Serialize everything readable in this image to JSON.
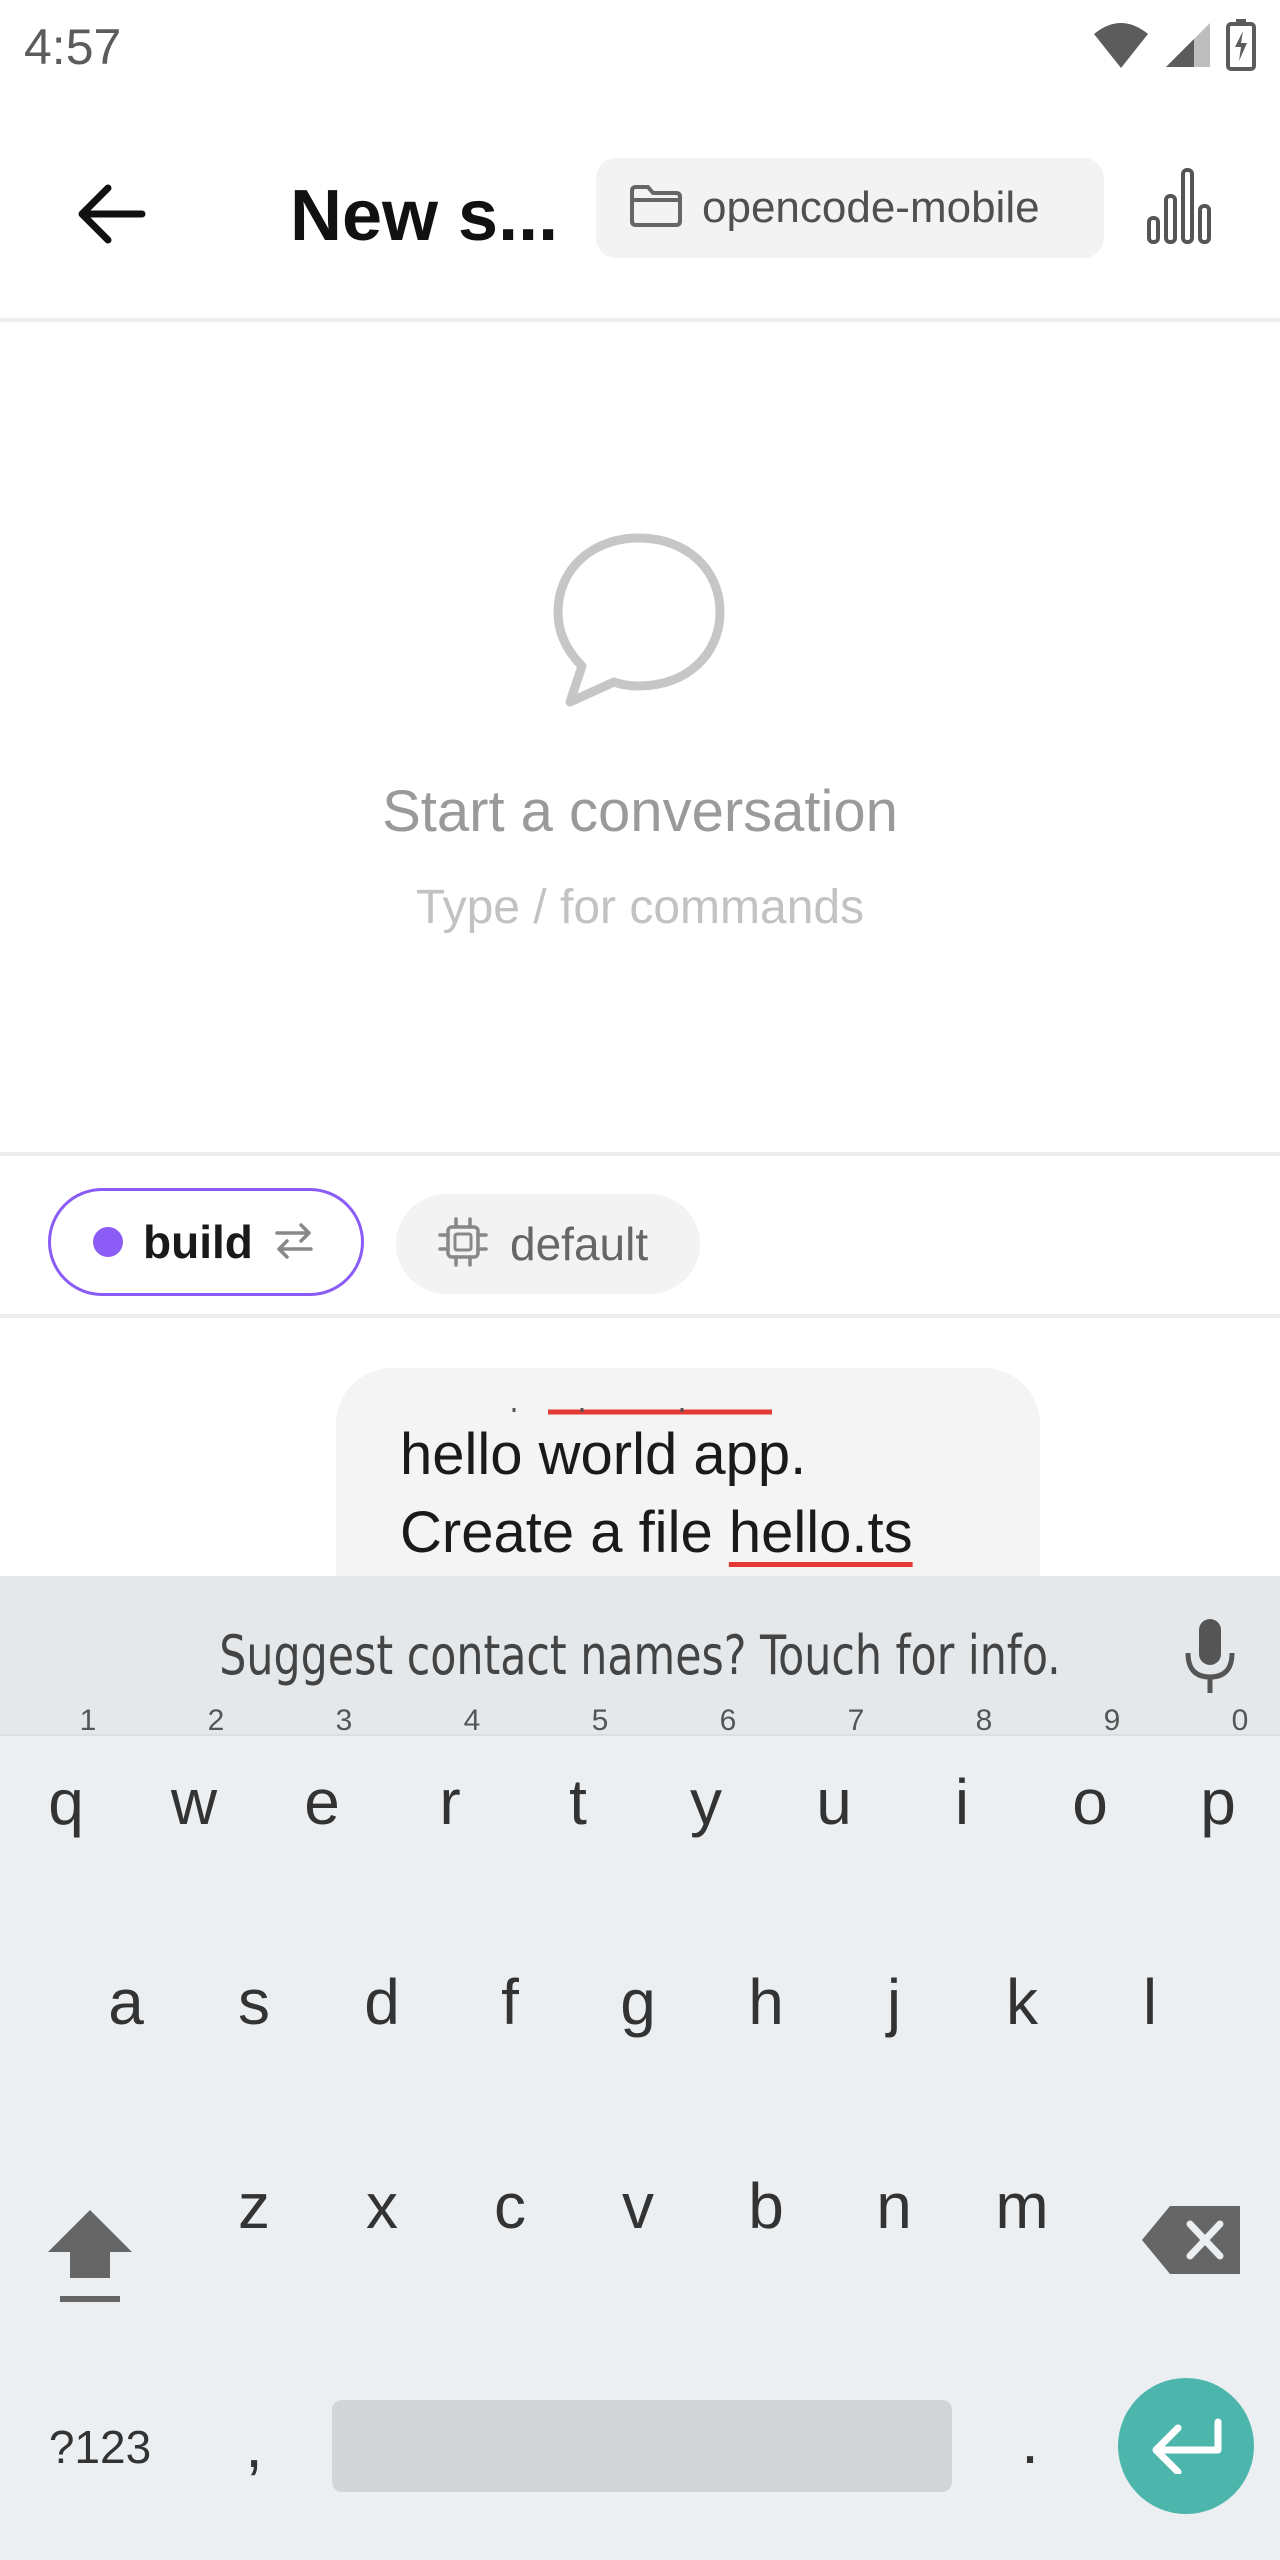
{
  "status_bar": {
    "time": "4:57"
  },
  "header": {
    "title": "New s...",
    "project": "opencode-mobile"
  },
  "empty_state": {
    "title": "Start a conversation",
    "subtitle": "Type / for commands"
  },
  "chips": {
    "agent": "build",
    "model": "default"
  },
  "message": {
    "line1": "hello world app.",
    "line2_prefix": "Create a file ",
    "line2_file": "hello.ts"
  },
  "keyboard": {
    "suggestion": "Suggest contact names? Touch for info.",
    "row1": [
      "q",
      "w",
      "e",
      "r",
      "t",
      "y",
      "u",
      "i",
      "o",
      "p"
    ],
    "row1_hints": [
      "1",
      "2",
      "3",
      "4",
      "5",
      "6",
      "7",
      "8",
      "9",
      "0"
    ],
    "row2": [
      "a",
      "s",
      "d",
      "f",
      "g",
      "h",
      "j",
      "k",
      "l"
    ],
    "row3": [
      "z",
      "x",
      "c",
      "v",
      "b",
      "n",
      "m"
    ],
    "symbols": "?123",
    "comma": ",",
    "period": "."
  },
  "colors": {
    "accent": "#8b5cf6",
    "enter": "#4db6ac",
    "keyboard_bg": "#eceff1"
  }
}
